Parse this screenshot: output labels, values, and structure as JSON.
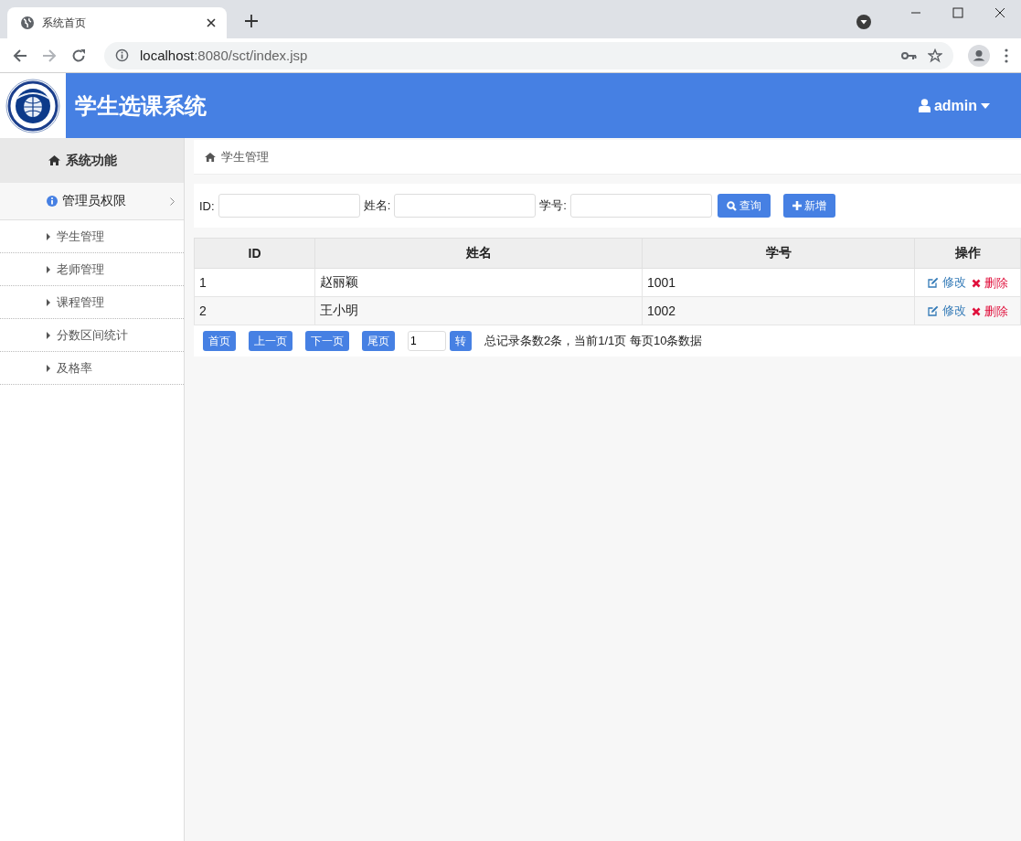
{
  "browser": {
    "tab_title": "系统首页",
    "url_host": "localhost",
    "url_path": ":8080/sct/index.jsp"
  },
  "header": {
    "title": "学生选课系统",
    "user": "admin"
  },
  "sidebar": {
    "heading": "系统功能",
    "group": "管理员权限",
    "items": [
      "学生管理",
      "老师管理",
      "课程管理",
      "分数区间统计",
      "及格率"
    ]
  },
  "breadcrumb": "学生管理",
  "search": {
    "fields": [
      {
        "label": "ID:"
      },
      {
        "label": "姓名:"
      },
      {
        "label": "学号:"
      }
    ],
    "buttons": [
      {
        "kind": "search",
        "label": "查询"
      },
      {
        "kind": "add",
        "label": "新增"
      }
    ]
  },
  "table": {
    "columns": [
      "ID",
      "姓名",
      "学号",
      "操作"
    ],
    "rows": [
      {
        "cells": [
          "1",
          "赵丽颖",
          "1001"
        ],
        "actions": [
          {
            "kind": "edit",
            "label": "修改"
          },
          {
            "kind": "delete",
            "label": "删除"
          }
        ]
      },
      {
        "cells": [
          "2",
          "王小明",
          "1002"
        ],
        "actions": [
          {
            "kind": "edit",
            "label": "修改"
          },
          {
            "kind": "delete",
            "label": "删除"
          }
        ]
      }
    ]
  },
  "pager": {
    "buttons": [
      "首页",
      "上一页",
      "下一页",
      "尾页"
    ],
    "page_value": "1",
    "go": "转",
    "summary": "总记录条数2条，当前1/1页 每页10条数据"
  }
}
